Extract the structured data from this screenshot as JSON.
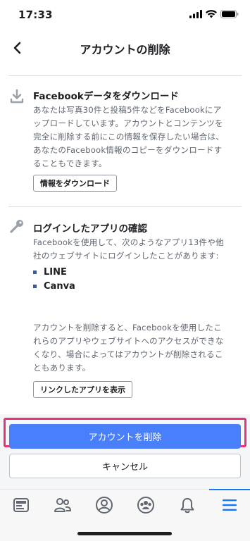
{
  "status_bar": {
    "time": "17:33"
  },
  "nav": {
    "title": "アカウントの削除"
  },
  "download_section": {
    "title": "Facebookデータをダウンロード",
    "body_lines": [
      "あなたは写真30件と投稿5件などをFacebookにア",
      "ップロードしています。アカウントとコンテンツを",
      "完全に削除する前にこの情報を保存したい場合は、",
      "あなたのFacebook情報のコピーをダウンロードす",
      "ることもできます。"
    ],
    "button_label": "情報をダウンロード"
  },
  "apps_section": {
    "title": "ログインしたアプリの確認",
    "intro_lines": [
      "Facebookを使用して、次のようなアプリ13件や他",
      "社のウェブサイトにログインしたことがあります:"
    ],
    "apps": [
      "LINE",
      "Canva"
    ],
    "note_lines": [
      "アカウントを削除すると、Facebookを使用したこ",
      "れらのアプリやウェブサイトへのアクセスができな",
      "くなり、場合によってはアカウントが削除されるこ",
      "ともあります。"
    ],
    "button_label": "リンクしたアプリを表示"
  },
  "actions": {
    "delete_label": "アカウントを削除",
    "cancel_label": "キャンセル",
    "primary_color": "#4a7ffb",
    "highlight_color": "#e2357a"
  },
  "tab_bar": {
    "tabs": [
      {
        "icon": "news-feed-icon"
      },
      {
        "icon": "friends-icon"
      },
      {
        "icon": "profile-icon"
      },
      {
        "icon": "groups-icon"
      },
      {
        "icon": "notifications-icon"
      },
      {
        "icon": "menu-icon",
        "active": true
      }
    ],
    "accent_color": "#1877f2"
  }
}
